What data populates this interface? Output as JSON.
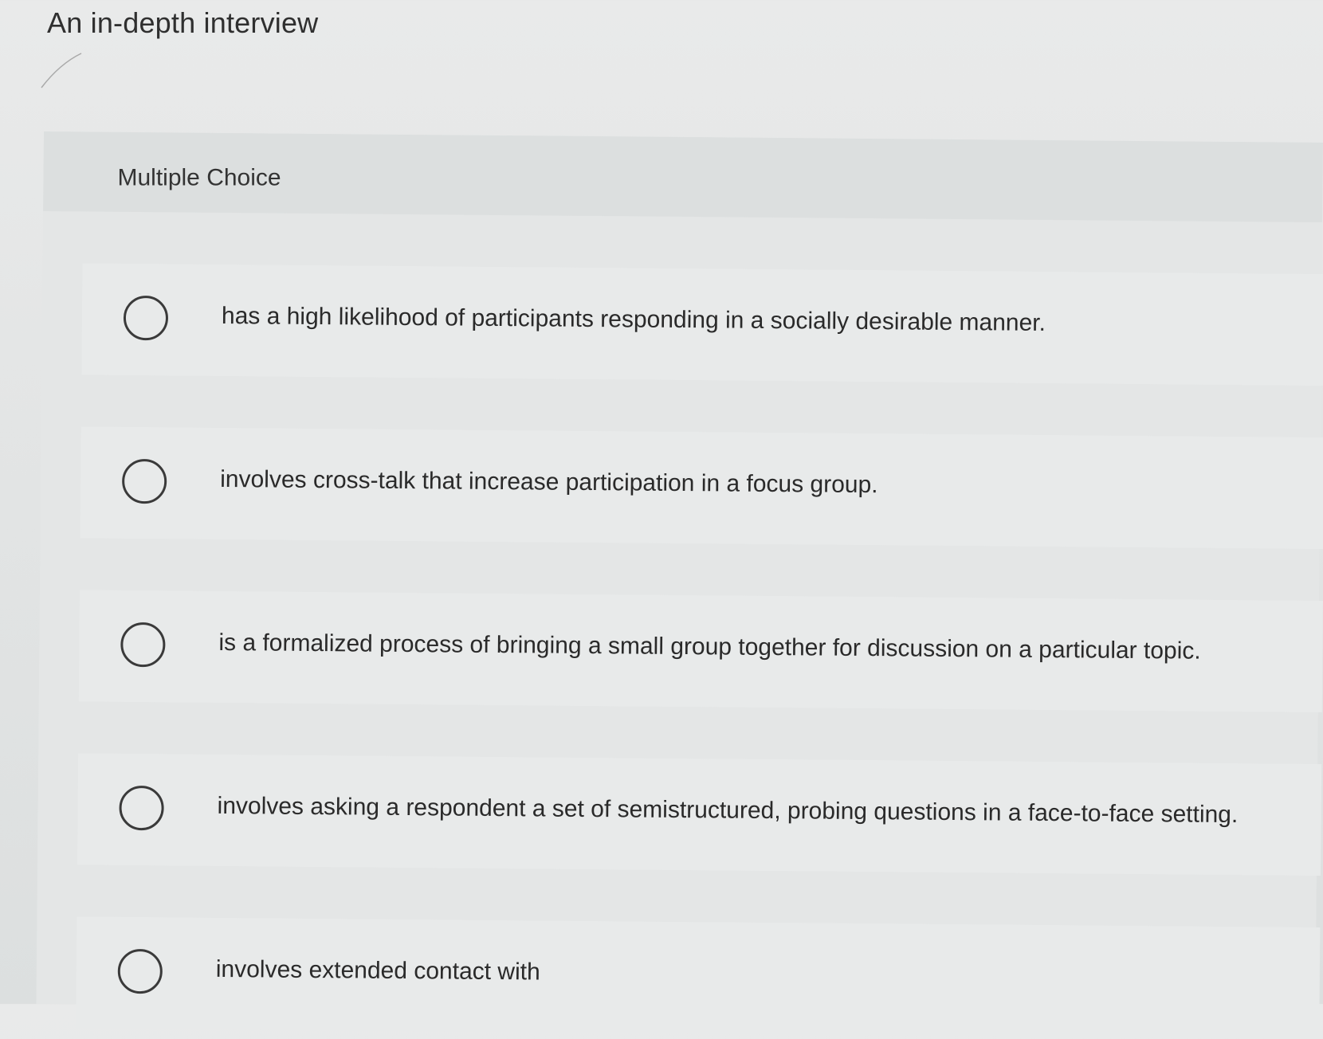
{
  "question": {
    "prompt": "An in-depth interview",
    "type_label": "Multiple Choice"
  },
  "choices": [
    {
      "label": "has a high likelihood of participants responding in a socially desirable manner."
    },
    {
      "label": "involves cross-talk that increase participation in a focus group."
    },
    {
      "label": "is a formalized process of bringing a small group together for discussion on a particular topic."
    },
    {
      "label": "involves asking a respondent a set of semistructured, probing questions in a face-to-face setting."
    },
    {
      "label": "involves extended contact with"
    }
  ]
}
